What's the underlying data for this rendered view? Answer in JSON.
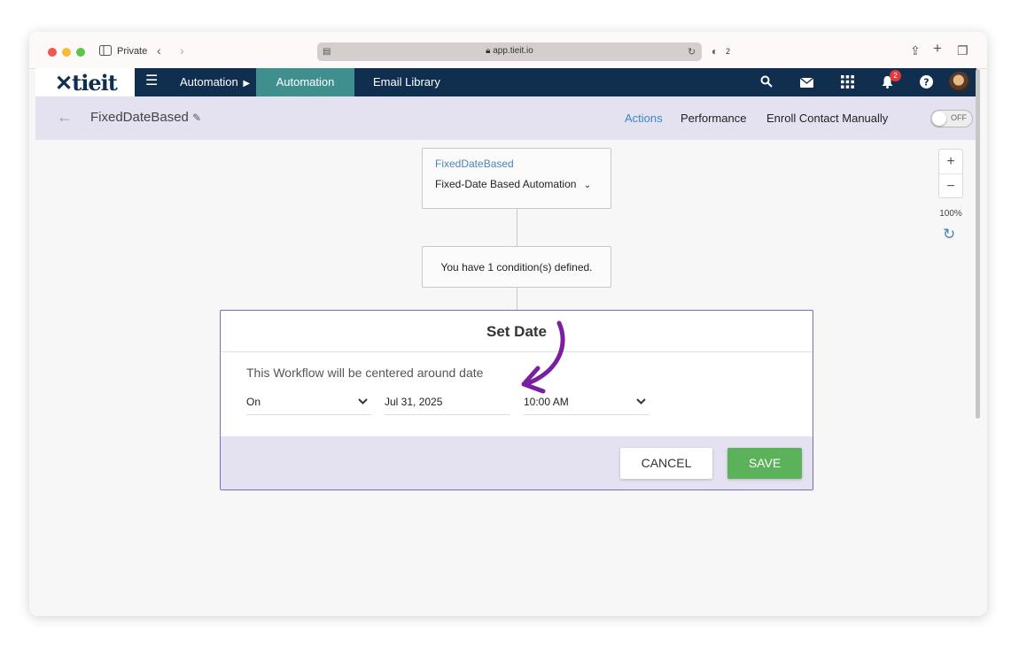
{
  "browser": {
    "private_label": "Private",
    "url": "app.tieit.io",
    "shield_count": "2"
  },
  "nav": {
    "logo": "tieit",
    "automation_dropdown": "Automation",
    "automation_tab": "Automation",
    "email_library": "Email Library",
    "notification_count": "2"
  },
  "subheader": {
    "workflow_name": "FixedDateBased",
    "tabs": {
      "actions": "Actions",
      "performance": "Performance",
      "enroll": "Enroll Contact Manually"
    },
    "toggle_label": "OFF",
    "accent": "#3c86c3"
  },
  "canvas": {
    "trigger_node": {
      "title": "FixedDateBased",
      "type": "Fixed-Date Based Automation"
    },
    "condition_node": {
      "text": "You have 1 condition(s) defined."
    },
    "zoom": {
      "plus": "+",
      "minus": "−",
      "level": "100%"
    }
  },
  "modal": {
    "title": "Set Date",
    "description": "This Workflow will be centered around date",
    "mode_select": "On",
    "date_value": "Jul 31, 2025",
    "time_select": "10:00 AM",
    "cancel_label": "CANCEL",
    "save_label": "SAVE",
    "save_color": "#5cb25b"
  },
  "annotation": {
    "arrow_color": "#7a1fa2"
  }
}
